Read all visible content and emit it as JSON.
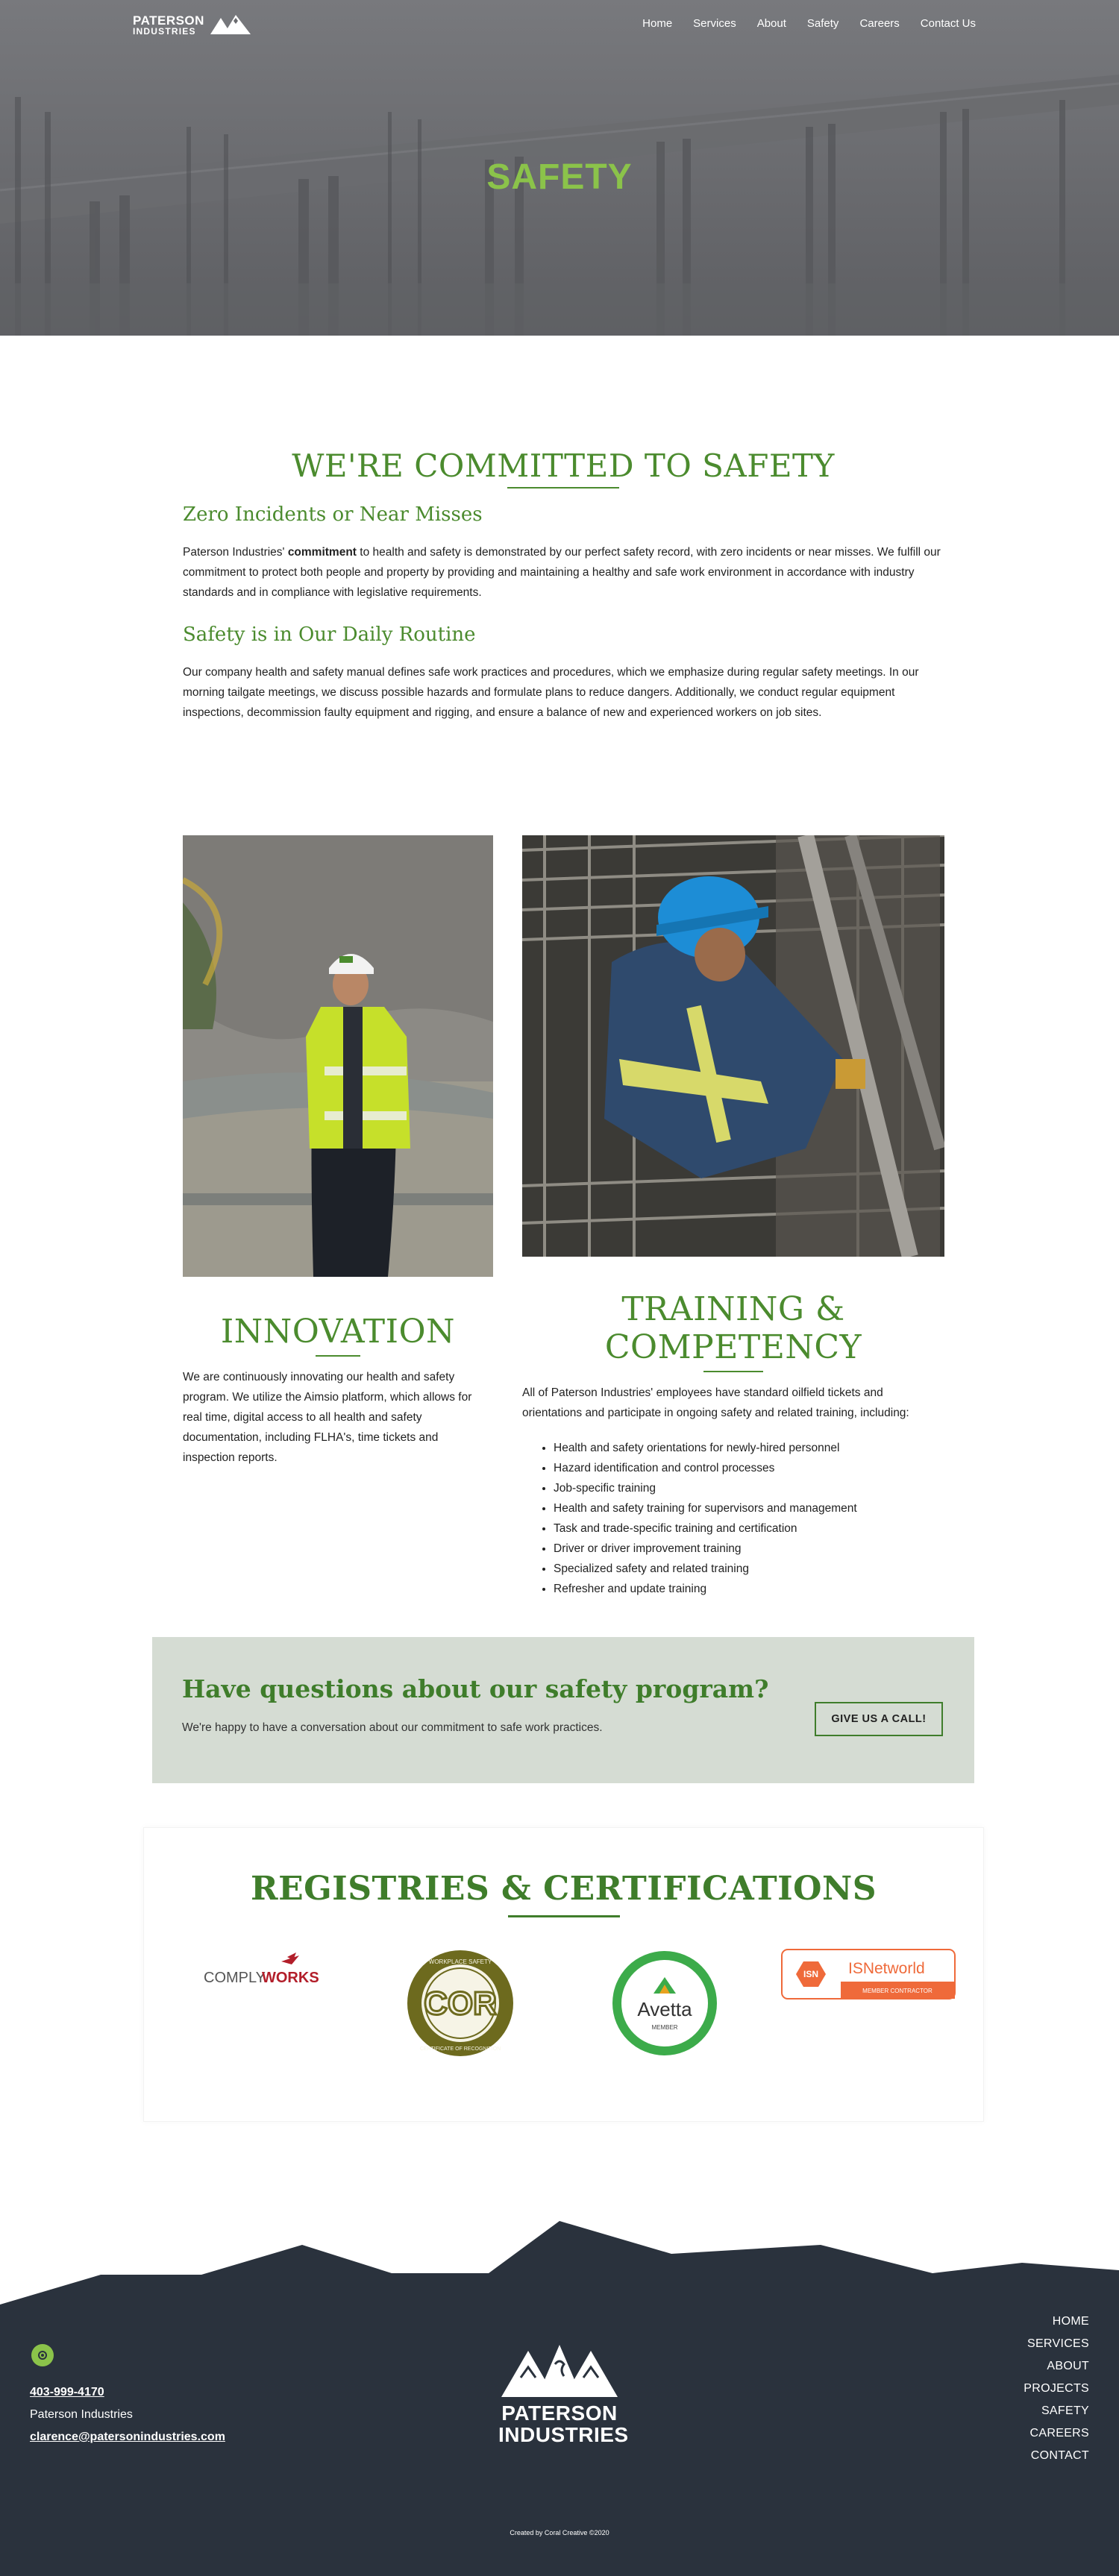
{
  "header": {
    "logo_name": "PATERSON",
    "logo_sub": "INDUSTRIES",
    "nav": [
      "Home",
      "Services",
      "About",
      "Safety",
      "Careers",
      "Contact Us"
    ],
    "hero_title": "SAFETY"
  },
  "commit": {
    "title": "WE'RE COMMITTED TO SAFETY",
    "sub1": "Zero Incidents or Near Misses",
    "p1_lead": "Paterson Industries' ",
    "p1_bold": "commitment",
    "p1_rest": " to health and safety is demonstrated by our perfect safety record, with zero incidents or near misses. We fulfill our commitment to protect both people and property by providing and maintaining a healthy and safe work environment in accordance with industry standards and in compliance with legislative requirements.",
    "sub2": "Safety is in Our Daily Routine",
    "p2": "Our company health and safety manual defines safe work practices and procedures, which we emphasize during regular safety meetings. In our morning tailgate meetings, we discuss possible hazards and formulate plans to reduce dangers. Additionally, we conduct regular equipment inspections, decommission faulty equipment and rigging, and ensure a balance of new and experienced workers on job sites."
  },
  "innovation": {
    "title": "INNOVATION",
    "text": "We are continuously innovating our health and safety program. We utilize the Aimsio platform, which allows for real time, digital access to all health and safety documentation, including FLHA's, time tickets and inspection reports."
  },
  "training": {
    "title": "TRAINING & COMPETENCY",
    "intro": "All of Paterson Industries' employees have standard oilfield tickets and orientations and participate in ongoing safety and related training, including:",
    "items": [
      "Health and safety orientations for newly-hired personnel",
      "Hazard identification and control processes",
      "Job-specific training",
      "Health and safety training for supervisors and management",
      "Task and trade-specific training and certification",
      "Driver or driver improvement training",
      "Specialized safety and related training",
      "Refresher and update training"
    ]
  },
  "cta": {
    "title": "Have questions about our safety program?",
    "subtitle": "We're happy to have a conversation about our commitment to safe work practices.",
    "button": "GIVE US A CALL!"
  },
  "registries": {
    "title": "REGISTRIES & CERTIFICATIONS",
    "complyworks_a": "COMPLY",
    "complyworks_b": "WORKS",
    "cor_text": "COR",
    "cor_ring_top": "WORKPLACE SAFETY",
    "cor_ring_bottom": "CERTIFICATE OF RECOGNITION",
    "avetta_text": "Avetta",
    "avetta_sub": "MEMBER",
    "isn_text": "ISNetworld",
    "isn_badge": "ISN",
    "isn_sub": "MEMBER CONTRACTOR"
  },
  "footer": {
    "phone": "403-999-4170",
    "company": "Paterson Industries",
    "email": "clarence@patersonindustries.com",
    "logo_line1": "PATERSON",
    "logo_line2": "INDUSTRIES",
    "nav": [
      "HOME",
      "SERVICES",
      "ABOUT",
      "PROJECTS",
      "SAFETY",
      "CAREERS",
      "CONTACT"
    ],
    "credit": "Created by Coral Creative ©2020"
  },
  "colors": {
    "accent": "#8bc34a",
    "heading_green": "#4b8b2e",
    "dark_green": "#3f7d2b",
    "footer_bg": "#2a323d",
    "cta_bg": "#d5dcd3"
  }
}
